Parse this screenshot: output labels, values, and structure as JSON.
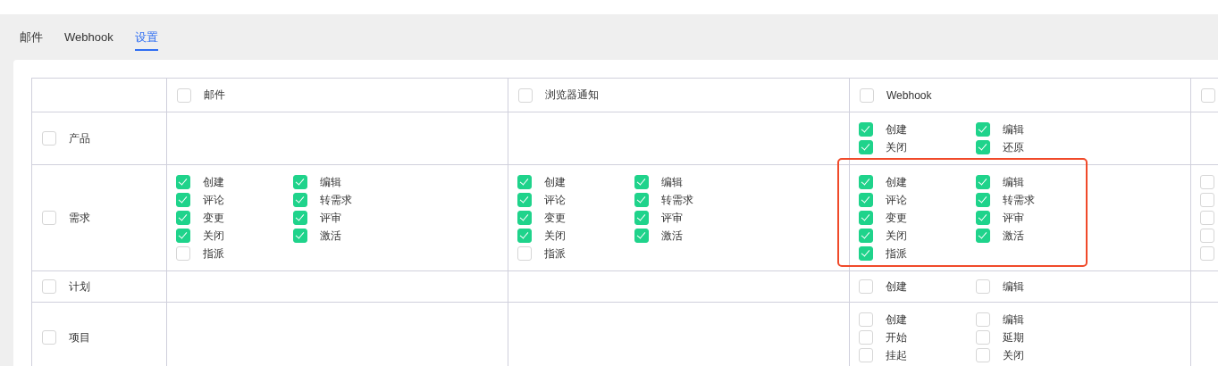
{
  "tabs": [
    {
      "label": "邮件",
      "selected": false
    },
    {
      "label": "Webhook",
      "selected": false
    },
    {
      "label": "设置",
      "selected": true
    }
  ],
  "table": {
    "columns": [
      {
        "label": "邮件",
        "checked": false
      },
      {
        "label": "浏览器通知",
        "checked": false
      },
      {
        "label": "Webhook",
        "checked": false
      },
      {
        "checked": false
      }
    ],
    "rows": [
      {
        "label": "产品",
        "checked": false,
        "cells": [
          {},
          {},
          {
            "items": [
              {
                "label": "创建",
                "checked": true
              },
              {
                "label": "编辑",
                "checked": true
              },
              {
                "label": "关闭",
                "checked": true
              },
              {
                "label": "还原",
                "checked": true
              }
            ]
          },
          {}
        ]
      },
      {
        "label": "需求",
        "checked": false,
        "cells": [
          {
            "items": [
              {
                "label": "创建",
                "checked": true
              },
              {
                "label": "编辑",
                "checked": true
              },
              {
                "label": "评论",
                "checked": true
              },
              {
                "label": "转需求",
                "checked": true
              },
              {
                "label": "变更",
                "checked": true
              },
              {
                "label": "评审",
                "checked": true
              },
              {
                "label": "关闭",
                "checked": true
              },
              {
                "label": "激活",
                "checked": true
              },
              {
                "label": "指派",
                "checked": false
              }
            ]
          },
          {
            "items": [
              {
                "label": "创建",
                "checked": true
              },
              {
                "label": "编辑",
                "checked": true
              },
              {
                "label": "评论",
                "checked": true
              },
              {
                "label": "转需求",
                "checked": true
              },
              {
                "label": "变更",
                "checked": true
              },
              {
                "label": "评审",
                "checked": true
              },
              {
                "label": "关闭",
                "checked": true
              },
              {
                "label": "激活",
                "checked": true
              },
              {
                "label": "指派",
                "checked": false
              }
            ]
          },
          {
            "highlight": true,
            "items": [
              {
                "label": "创建",
                "checked": true
              },
              {
                "label": "编辑",
                "checked": true
              },
              {
                "label": "评论",
                "checked": true
              },
              {
                "label": "转需求",
                "checked": true
              },
              {
                "label": "变更",
                "checked": true
              },
              {
                "label": "评审",
                "checked": true
              },
              {
                "label": "关闭",
                "checked": true
              },
              {
                "label": "激活",
                "checked": true
              },
              {
                "label": "指派",
                "checked": true
              }
            ]
          },
          {
            "items": [
              {
                "checked": false
              },
              {
                "checked": false
              },
              {
                "checked": false
              },
              {
                "checked": false
              },
              {
                "checked": false
              }
            ]
          }
        ]
      },
      {
        "label": "计划",
        "checked": false,
        "cells": [
          {},
          {},
          {
            "items": [
              {
                "label": "创建",
                "checked": false
              },
              {
                "label": "编辑",
                "checked": false
              }
            ]
          },
          {}
        ]
      },
      {
        "label": "项目",
        "checked": false,
        "cells": [
          {},
          {},
          {
            "items": [
              {
                "label": "创建",
                "checked": false
              },
              {
                "label": "编辑",
                "checked": false
              },
              {
                "label": "开始",
                "checked": false
              },
              {
                "label": "延期",
                "checked": false
              },
              {
                "label": "挂起",
                "checked": false
              },
              {
                "label": "关闭",
                "checked": false
              }
            ]
          },
          {}
        ]
      }
    ]
  }
}
